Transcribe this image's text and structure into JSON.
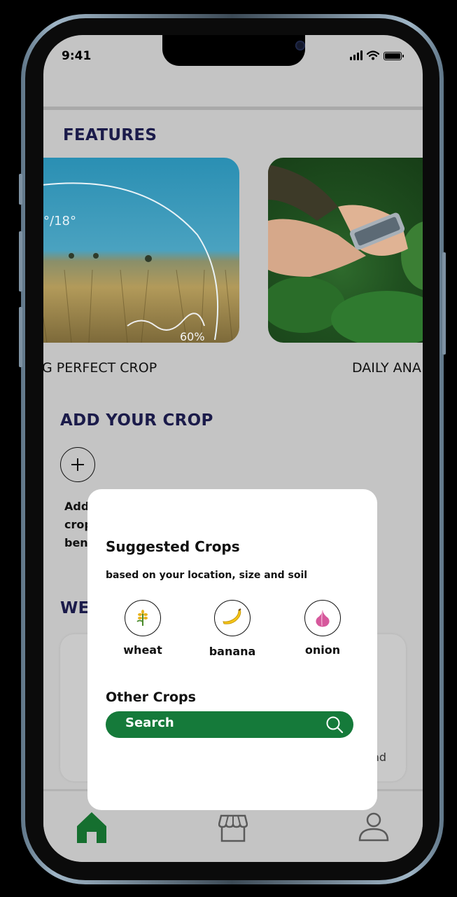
{
  "status_bar": {
    "time": "9:41"
  },
  "features": {
    "title": "FEATURES",
    "cards": [
      {
        "caption": "G PERFECT CROP",
        "overlay_temp": "°/18°",
        "overlay_percent": "60%"
      },
      {
        "caption": "DAILY ANA"
      }
    ]
  },
  "add_crop": {
    "title": "ADD YOUR CROP",
    "partial_lines": [
      "Add",
      "crop",
      "ben"
    ]
  },
  "weather": {
    "title_partial": "WE",
    "partial_right": "nd"
  },
  "modal": {
    "title": "Suggested Crops",
    "subtitle": "based on your location, size and soil",
    "crops": [
      {
        "label": "wheat",
        "icon": "wheat-icon",
        "color": "#e7b21b"
      },
      {
        "label": "banana",
        "icon": "banana-icon",
        "color": "#f5c518"
      },
      {
        "label": "onion",
        "icon": "onion-icon",
        "color": "#d6589c"
      }
    ],
    "other_title": "Other Crops",
    "search": {
      "label": "Search",
      "color": "#157a3a"
    }
  },
  "bottom_nav": {
    "items": [
      {
        "icon": "home-icon",
        "active": true,
        "color": "#156f2f"
      },
      {
        "icon": "store-icon",
        "active": false
      },
      {
        "icon": "profile-icon",
        "active": false
      }
    ]
  }
}
